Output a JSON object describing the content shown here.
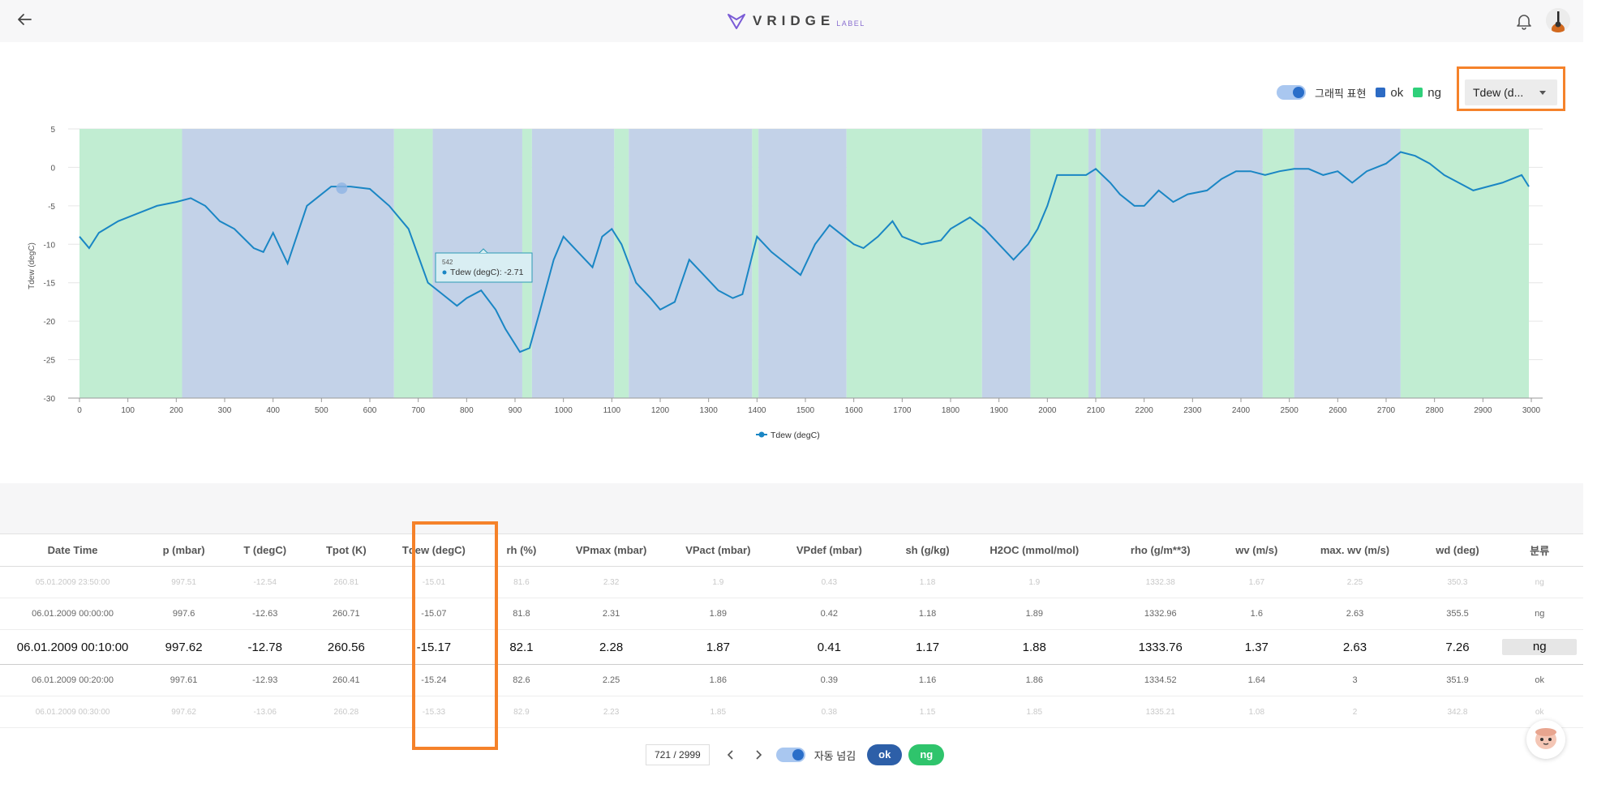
{
  "header": {
    "brand_word": "VRIDGE",
    "brand_sub": "LABEL"
  },
  "controls": {
    "graphic_toggle_label": "그래픽 표현",
    "legend": [
      {
        "label": "ok",
        "color": "#2d6bc4"
      },
      {
        "label": "ng",
        "color": "#2fd07a"
      }
    ],
    "dropdown_value": "Tdew (d..."
  },
  "chart_data": {
    "type": "line",
    "ylabel": "Tdew (degC)",
    "legend_label": "Tdew (degC)",
    "xlim": [
      0,
      3000
    ],
    "ylim": [
      -30,
      5
    ],
    "x_ticks": [
      "0",
      "100",
      "200",
      "300",
      "400",
      "500",
      "600",
      "700",
      "800",
      "900",
      "1000",
      "1100",
      "1200",
      "1300",
      "1400",
      "1500",
      "1600",
      "1700",
      "1800",
      "1900",
      "2000",
      "2100",
      "2200",
      "2300",
      "2400",
      "2500",
      "2600",
      "2700",
      "2800",
      "2900",
      "3000"
    ],
    "y_ticks": [
      "5",
      "0",
      "-5",
      "-10",
      "-15",
      "-20",
      "-25",
      "-30"
    ],
    "line_color": "#1a86c4",
    "band_colors": {
      "ok": "#c3d2e8",
      "ng": "#c1edd2"
    },
    "bands": [
      {
        "from": 0,
        "to": 212,
        "label": "ng"
      },
      {
        "from": 212,
        "to": 650,
        "label": "ok"
      },
      {
        "from": 650,
        "to": 730,
        "label": "ng"
      },
      {
        "from": 730,
        "to": 915,
        "label": "ok"
      },
      {
        "from": 915,
        "to": 935,
        "label": "ng"
      },
      {
        "from": 935,
        "to": 1105,
        "label": "ok"
      },
      {
        "from": 1105,
        "to": 1135,
        "label": "ng"
      },
      {
        "from": 1135,
        "to": 1390,
        "label": "ok"
      },
      {
        "from": 1390,
        "to": 1403,
        "label": "ng"
      },
      {
        "from": 1403,
        "to": 1585,
        "label": "ok"
      },
      {
        "from": 1585,
        "to": 1865,
        "label": "ng"
      },
      {
        "from": 1865,
        "to": 1965,
        "label": "ok"
      },
      {
        "from": 1965,
        "to": 2085,
        "label": "ng"
      },
      {
        "from": 2085,
        "to": 2100,
        "label": "ok"
      },
      {
        "from": 2100,
        "to": 2110,
        "label": "ng"
      },
      {
        "from": 2110,
        "to": 2445,
        "label": "ok"
      },
      {
        "from": 2445,
        "to": 2510,
        "label": "ng"
      },
      {
        "from": 2510,
        "to": 2730,
        "label": "ok"
      },
      {
        "from": 2730,
        "to": 2995,
        "label": "ng"
      }
    ],
    "series": [
      {
        "name": "Tdew (degC)",
        "x": [
          0,
          20,
          40,
          80,
          120,
          160,
          200,
          230,
          260,
          290,
          320,
          360,
          380,
          400,
          430,
          470,
          520,
          560,
          600,
          640,
          680,
          720,
          750,
          780,
          800,
          830,
          860,
          880,
          910,
          930,
          950,
          980,
          1000,
          1030,
          1060,
          1080,
          1100,
          1120,
          1150,
          1180,
          1200,
          1230,
          1260,
          1290,
          1320,
          1350,
          1370,
          1400,
          1430,
          1460,
          1490,
          1520,
          1550,
          1580,
          1600,
          1620,
          1650,
          1680,
          1700,
          1740,
          1780,
          1800,
          1840,
          1870,
          1900,
          1930,
          1960,
          1980,
          2000,
          2020,
          2050,
          2080,
          2100,
          2130,
          2150,
          2180,
          2200,
          2230,
          2260,
          2290,
          2330,
          2360,
          2390,
          2420,
          2450,
          2480,
          2510,
          2540,
          2570,
          2600,
          2630,
          2660,
          2700,
          2730,
          2760,
          2790,
          2820,
          2850,
          2880,
          2910,
          2940,
          2960,
          2980,
          2995
        ],
        "y": [
          -9,
          -10.5,
          -8.5,
          -7,
          -6,
          -5,
          -4.5,
          -4,
          -5,
          -7,
          -8,
          -10.5,
          -11,
          -8.5,
          -12.5,
          -5,
          -2.5,
          -2.5,
          -2.8,
          -5,
          -8,
          -15,
          -16.5,
          -18,
          -17,
          -16,
          -18.5,
          -21,
          -24,
          -23.5,
          -19,
          -12,
          -9,
          -11,
          -13,
          -9,
          -8,
          -10,
          -15,
          -17,
          -18.5,
          -17.5,
          -12,
          -14,
          -16,
          -17,
          -16.5,
          -9,
          -11,
          -12.5,
          -14,
          -10,
          -7.5,
          -9,
          -10,
          -10.5,
          -9,
          -7,
          -9,
          -10,
          -9.5,
          -8,
          -6.5,
          -8,
          -10,
          -12,
          -10,
          -8,
          -5,
          -1,
          -1,
          -1,
          -0.2,
          -2,
          -3.5,
          -5,
          -5,
          -3,
          -4.5,
          -3.5,
          -3,
          -1.5,
          -0.5,
          -0.5,
          -1,
          -0.5,
          -0.2,
          -0.2,
          -1,
          -0.5,
          -2,
          -0.5,
          0.5,
          2,
          1.5,
          0.5,
          -1,
          -2,
          -3,
          -2.5,
          -2,
          -1.5,
          -1,
          -2.5
        ]
      }
    ],
    "hover_point": {
      "x": 542,
      "y": -2.71
    },
    "tooltip": {
      "title": "542",
      "text": "Tdew (degC): -2.71"
    }
  },
  "table": {
    "headers": [
      "Date Time",
      "p (mbar)",
      "T (degC)",
      "Tpot (K)",
      "Tdew (degC)",
      "rh (%)",
      "VPmax (mbar)",
      "VPact (mbar)",
      "VPdef (mbar)",
      "sh (g/kg)",
      "H2OC (mmol/mol)",
      "rho (g/m**3)",
      "wv (m/s)",
      "max. wv (m/s)",
      "wd (deg)",
      "분류"
    ],
    "rows": [
      [
        "05.01.2009 23:50:00",
        "997.51",
        "-12.54",
        "260.81",
        "-15.01",
        "81.6",
        "2.32",
        "1.9",
        "0.43",
        "1.18",
        "1.9",
        "1332.38",
        "1.67",
        "2.25",
        "350.3",
        "ng"
      ],
      [
        "06.01.2009 00:00:00",
        "997.6",
        "-12.63",
        "260.71",
        "-15.07",
        "81.8",
        "2.31",
        "1.89",
        "0.42",
        "1.18",
        "1.89",
        "1332.96",
        "1.6",
        "2.63",
        "355.5",
        "ng"
      ],
      [
        "06.01.2009 00:10:00",
        "997.62",
        "-12.78",
        "260.56",
        "-15.17",
        "82.1",
        "2.28",
        "1.87",
        "0.41",
        "1.17",
        "1.88",
        "1333.76",
        "1.37",
        "2.63",
        "7.26",
        "ng"
      ],
      [
        "06.01.2009 00:20:00",
        "997.61",
        "-12.93",
        "260.41",
        "-15.24",
        "82.6",
        "2.25",
        "1.86",
        "0.39",
        "1.16",
        "1.86",
        "1334.52",
        "1.64",
        "3",
        "351.9",
        "ok"
      ],
      [
        "06.01.2009 00:30:00",
        "997.62",
        "-13.06",
        "260.28",
        "-15.33",
        "82.9",
        "2.23",
        "1.85",
        "0.38",
        "1.15",
        "1.85",
        "1335.21",
        "1.08",
        "2",
        "342.8",
        "ok"
      ]
    ]
  },
  "pager": {
    "position": "721 / 2999",
    "auto_label": "자동 넘김",
    "ok_label": "ok",
    "ng_label": "ng"
  }
}
